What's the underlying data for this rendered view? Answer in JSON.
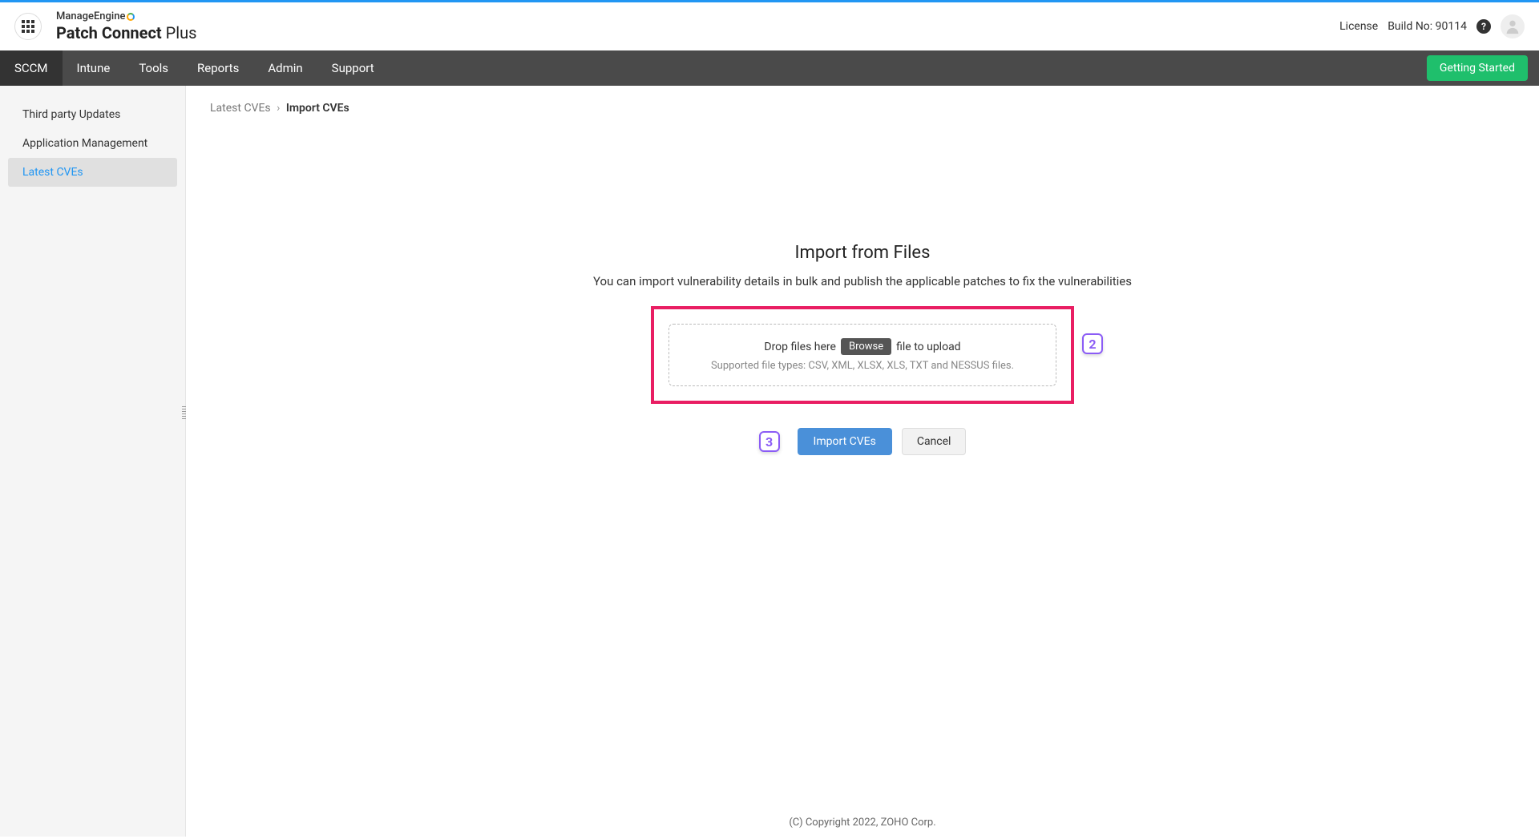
{
  "header": {
    "brand_top": "ManageEngine",
    "brand_bottom_bold": "Patch Connect",
    "brand_bottom_light": " Plus",
    "license_label": "License",
    "build_label": "Build No: 90114"
  },
  "nav": {
    "items": [
      "SCCM",
      "Intune",
      "Tools",
      "Reports",
      "Admin",
      "Support"
    ],
    "active": "SCCM",
    "getting_started": "Getting Started"
  },
  "sidebar": {
    "items": [
      "Third party Updates",
      "Application Management",
      "Latest CVEs"
    ],
    "active": "Latest CVEs"
  },
  "breadcrumb": {
    "parent": "Latest CVEs",
    "current": "Import CVEs"
  },
  "import": {
    "title": "Import from Files",
    "subtitle": "You can import vulnerability details in bulk and publish the applicable patches to fix the vulnerabilities",
    "drop_prefix": "Drop files here",
    "browse": "Browse",
    "drop_suffix": "file to upload",
    "supported": "Supported file types: CSV, XML, XLSX, XLS, TXT and NESSUS files.",
    "badge2": "2",
    "badge3": "3",
    "import_btn": "Import CVEs",
    "cancel_btn": "Cancel"
  },
  "footer": {
    "copyright": "(C) Copyright 2022, ZOHO Corp."
  }
}
